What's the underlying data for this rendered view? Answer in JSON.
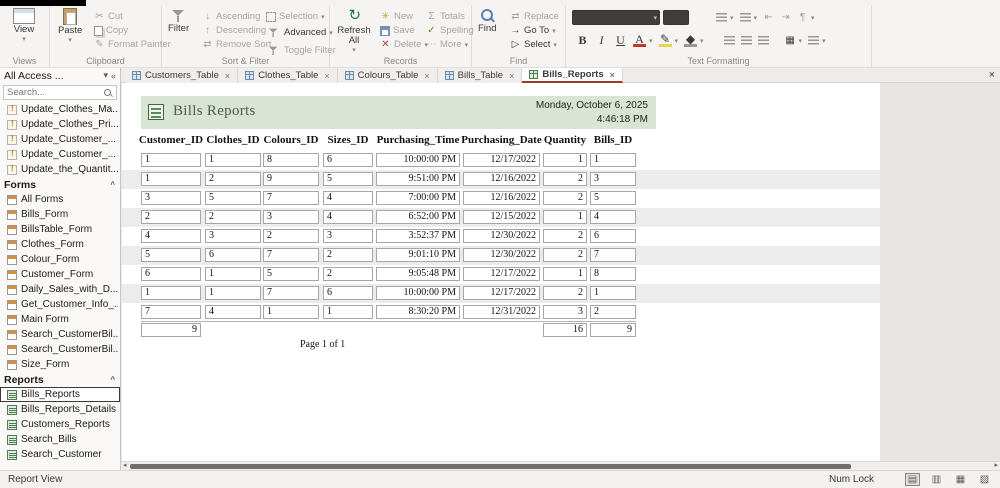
{
  "ribbon": {
    "groups": [
      {
        "label": "Views"
      },
      {
        "label": "Clipboard"
      },
      {
        "label": "Sort & Filter"
      },
      {
        "label": "Records"
      },
      {
        "label": "Find"
      },
      {
        "label": "Text Formatting"
      }
    ],
    "buttons": {
      "view": "View",
      "paste": "Paste",
      "cut": "Cut",
      "copy": "Copy",
      "format_painter": "Format Painter",
      "filter": "Filter",
      "ascending": "Ascending",
      "descending": "Descending",
      "remove_sort": "Remove Sort",
      "selection": "Selection",
      "advanced": "Advanced",
      "toggle_filter": "Toggle Filter",
      "refresh_all": "Refresh All",
      "new": "New",
      "save": "Save",
      "delete": "Delete",
      "totals": "Totals",
      "spelling": "Spelling",
      "more": "More",
      "find": "Find",
      "replace": "Replace",
      "go_to": "Go To",
      "select": "Select"
    },
    "formatting": {
      "bold": "B",
      "italic": "I",
      "underline": "U"
    }
  },
  "tabs": {
    "items": [
      {
        "label": "Customers_Table",
        "icon": "table",
        "active": false
      },
      {
        "label": "Clothes_Table",
        "icon": "table",
        "active": false
      },
      {
        "label": "Colours_Table",
        "icon": "table",
        "active": false
      },
      {
        "label": "Bills_Table",
        "icon": "table",
        "active": false
      },
      {
        "label": "Bills_Reports",
        "icon": "report",
        "active": true
      }
    ]
  },
  "sidebar": {
    "title": "All Access ...",
    "search_value": "Search...",
    "macros": [
      "Update_Clothes_Ma...",
      "Update_Clothes_Pri...",
      "Update_Customer_...",
      "Update_Customer_...",
      "Update_the_Quantit..."
    ],
    "forms_header": "Forms",
    "forms": [
      "All Forms",
      "Bills_Form",
      "BillsTable_Form",
      "Clothes_Form",
      "Colour_Form",
      "Customer_Form",
      "Daily_Sales_with_D...",
      "Get_Customer_Info_...",
      "Main Form",
      "Search_CustomerBil...",
      "Search_CustomerBil...",
      "Size_Form"
    ],
    "reports_header": "Reports",
    "reports": [
      "Bills_Reports",
      "Bills_Reports_Details",
      "Customers_Reports",
      "Search_Bills",
      "Search_Customer"
    ],
    "selected_report": "Bills_Reports"
  },
  "report": {
    "title": "Bills Reports",
    "date": "Monday, October 6, 2025",
    "time": "4:46:18 PM",
    "columns": [
      "Customer_ID",
      "Clothes_ID",
      "Colours_ID",
      "Sizes_ID",
      "Purchasing_Time",
      "Purchasing_Date",
      "Quantity",
      "Bills_ID"
    ],
    "rows": [
      [
        "1",
        "1",
        "8",
        "6",
        "10:00:00 PM",
        "12/17/2022",
        "1",
        "1"
      ],
      [
        "1",
        "2",
        "9",
        "5",
        "9:51:00 PM",
        "12/16/2022",
        "2",
        "3"
      ],
      [
        "3",
        "5",
        "7",
        "4",
        "7:00:00 PM",
        "12/16/2022",
        "2",
        "5"
      ],
      [
        "2",
        "2",
        "3",
        "4",
        "6:52:00 PM",
        "12/15/2022",
        "1",
        "4"
      ],
      [
        "4",
        "3",
        "2",
        "3",
        "3:52:37 PM",
        "12/30/2022",
        "2",
        "6"
      ],
      [
        "5",
        "6",
        "7",
        "2",
        "9:01:10 PM",
        "12/30/2022",
        "2",
        "7"
      ],
      [
        "6",
        "1",
        "5",
        "2",
        "9:05:48 PM",
        "12/17/2022",
        "1",
        "8"
      ],
      [
        "1",
        "1",
        "7",
        "6",
        "10:00:00 PM",
        "12/17/2022",
        "2",
        "1"
      ],
      [
        "7",
        "4",
        "1",
        "1",
        "8:30:20 PM",
        "12/31/2022",
        "3",
        "2"
      ]
    ],
    "record_count": "9",
    "quantity_total": "16",
    "bills_total": "9",
    "page_label": "Page 1 of 1"
  },
  "statusbar": {
    "view_label": "Report View",
    "num_lock": "Num Lock"
  }
}
